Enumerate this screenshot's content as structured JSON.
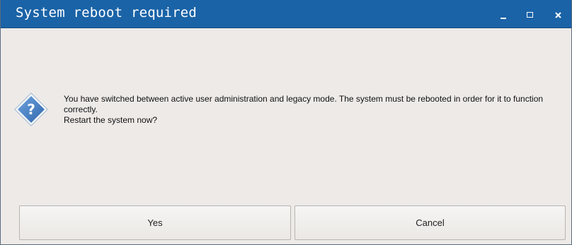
{
  "window": {
    "title": "System reboot required"
  },
  "titlebar_controls": {
    "minimize_icon": "minimize-icon",
    "maximize_icon": "maximize-icon",
    "close_icon": "close-icon"
  },
  "dialog": {
    "icon": "question-icon",
    "message_lines": [
      "You have switched between active user administration and legacy mode. The system must be rebooted in order for it to function correctly.",
      "Restart the system now?"
    ]
  },
  "buttons": {
    "yes_label": "Yes",
    "cancel_label": "Cancel"
  },
  "colors": {
    "titlebar": "#1a63a7",
    "dialog_background": "#edeae8",
    "icon_fill": "#3d7bc4"
  }
}
